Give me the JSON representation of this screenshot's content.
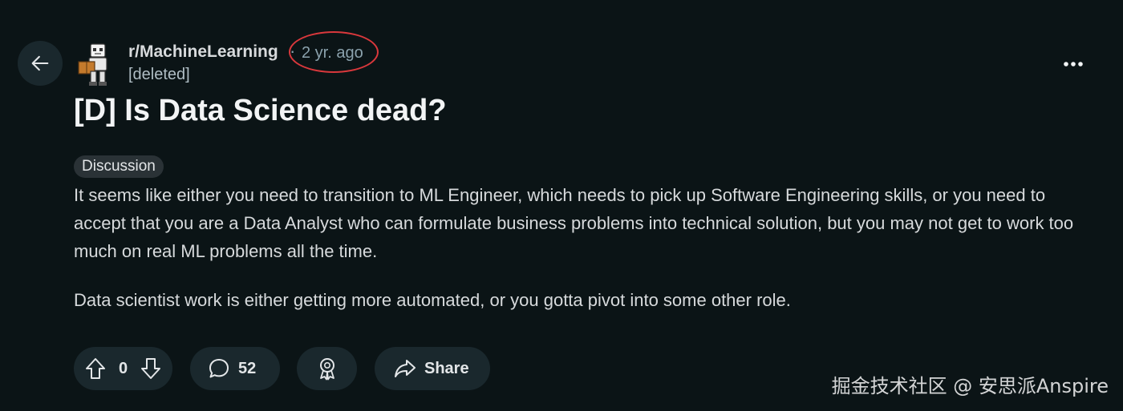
{
  "post_header": {
    "subreddit": "r/MachineLearning",
    "separator": "·",
    "timestamp": "2 yr. ago",
    "author": "[deleted]"
  },
  "post": {
    "title": "[D] Is Data Science dead?",
    "flair": "Discussion",
    "paragraphs": [
      "It seems like either you need to transition to ML Engineer, which needs to pick up Software Engineering skills, or you need to accept that you are a Data Analyst who can formulate business problems into technical solution, but you may not get to work too much on real ML problems all the time.",
      "Data scientist work is either getting more automated, or you gotta pivot into some other role."
    ]
  },
  "actions": {
    "vote_count": "0",
    "comment_count": "52",
    "share_label": "Share"
  },
  "icons": {
    "back": "arrow-left-icon",
    "more": "more-horizontal-icon",
    "upvote": "upvote-arrow-icon",
    "downvote": "downvote-arrow-icon",
    "comment": "comment-bubble-icon",
    "award": "award-ribbon-icon",
    "share": "share-arrow-icon"
  },
  "watermark": "掘金技术社区 @ 安思派Anspire",
  "colors": {
    "background": "#0b1416",
    "pill_background": "#1a282d",
    "highlight_circle": "#d9383c"
  }
}
